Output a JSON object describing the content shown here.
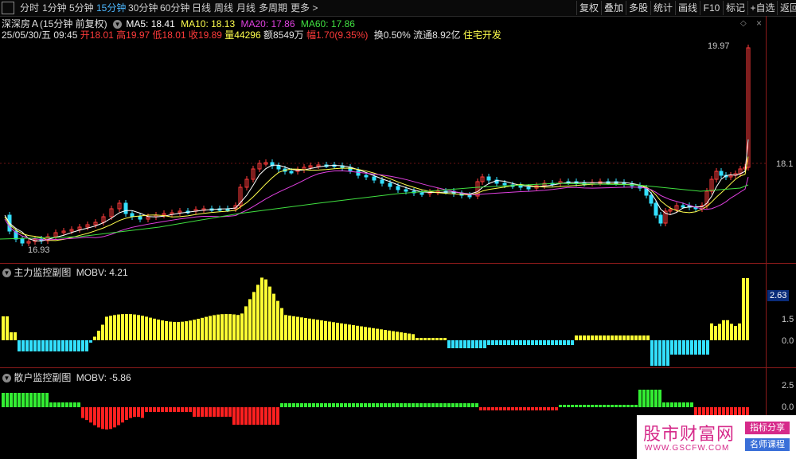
{
  "toolbar": {
    "periods": [
      "分时",
      "1分钟",
      "5分钟",
      "15分钟",
      "30分钟",
      "60分钟",
      "日线",
      "周线",
      "月线",
      "多周期",
      "更多"
    ],
    "active_period": "15分钟",
    "right_buttons": [
      "复权",
      "叠加",
      "多股",
      "统计",
      "画线",
      "F10",
      "标记",
      "+自选",
      "返回"
    ]
  },
  "stock": {
    "name_line": "深深房Ａ(15分钟 前复权)",
    "ma5": "MA5: 18.41",
    "ma10": "MA10: 18.13",
    "ma20": "MA20: 17.86",
    "ma60": "MA60: 17.86",
    "datetime": "25/05/30/五 09:45",
    "open": "开18.01",
    "high": "高19.97",
    "low": "低18.01",
    "close": "收19.89",
    "volume": "量44296",
    "amount": "额8549万",
    "change": "幅1.70(9.35%)",
    "turnover": "换0.50%",
    "float": "流通8.92亿",
    "sector": "住宅开发"
  },
  "price_panel": {
    "high_marker": "19.97",
    "low_marker": "16.93",
    "axis_label": "18.1"
  },
  "mobv_panel": {
    "title": "主力监控副图",
    "indicator": "MOBV: 4.21",
    "axis": [
      "2.63",
      "1.5",
      "0.0"
    ]
  },
  "retail_panel": {
    "title": "散户监控副图",
    "indicator": "MOBV: -5.86",
    "axis": [
      "2.5",
      "0.0"
    ]
  },
  "watermark": {
    "title": "股市财富网",
    "url": "WWW.GSCFW.COM",
    "tag1": "指标分享",
    "tag2": "名师课程"
  },
  "colors": {
    "up": "#ff3b3b",
    "down": "#33e0ff",
    "ma5": "#ffffff",
    "ma10": "#ffff4d",
    "ma20": "#e040e0",
    "ma60": "#40e040",
    "mobv_pos": "#ffff33",
    "mobv_neg": "#33e0ff",
    "retail_pos": "#33ee33",
    "retail_neg": "#ff2020",
    "border": "#8b1a1a"
  }
}
